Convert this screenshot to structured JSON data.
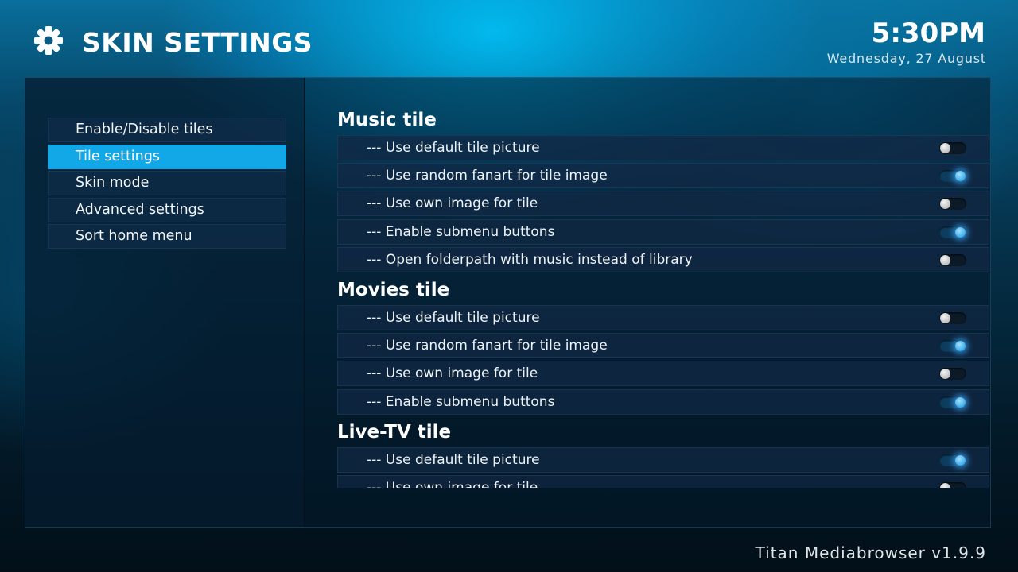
{
  "header": {
    "title": "SKIN SETTINGS",
    "icon": "gear-icon",
    "clock": "5:30PM",
    "date": "Wednesday, 27 August"
  },
  "menu": {
    "items": [
      {
        "label": "Enable/Disable tiles",
        "selected": false
      },
      {
        "label": "Tile settings",
        "selected": true
      },
      {
        "label": "Skin mode",
        "selected": false
      },
      {
        "label": "Advanced settings",
        "selected": false
      },
      {
        "label": "Sort home menu",
        "selected": false
      }
    ]
  },
  "sections": [
    {
      "title": "Music tile",
      "rows": [
        {
          "label": "--- Use default tile picture",
          "on": false
        },
        {
          "label": "--- Use random fanart for tile image",
          "on": true
        },
        {
          "label": "--- Use own image for tile",
          "on": false
        },
        {
          "label": "--- Enable submenu buttons",
          "on": true
        },
        {
          "label": "--- Open folderpath with music instead of library",
          "on": false
        }
      ]
    },
    {
      "title": "Movies tile",
      "rows": [
        {
          "label": "--- Use default tile picture",
          "on": false
        },
        {
          "label": "--- Use random fanart for tile image",
          "on": true
        },
        {
          "label": "--- Use own image for tile",
          "on": false
        },
        {
          "label": "--- Enable submenu buttons",
          "on": true
        }
      ]
    },
    {
      "title": "Live-TV tile",
      "rows": [
        {
          "label": "--- Use default tile picture",
          "on": true
        },
        {
          "label": "--- Use own image for tile",
          "on": false
        }
      ]
    }
  ],
  "footer": {
    "version": "Titan Mediabrowser v1.9.9"
  },
  "colors": {
    "accent": "#12a7e6",
    "toggle_on": "#1796dd"
  }
}
